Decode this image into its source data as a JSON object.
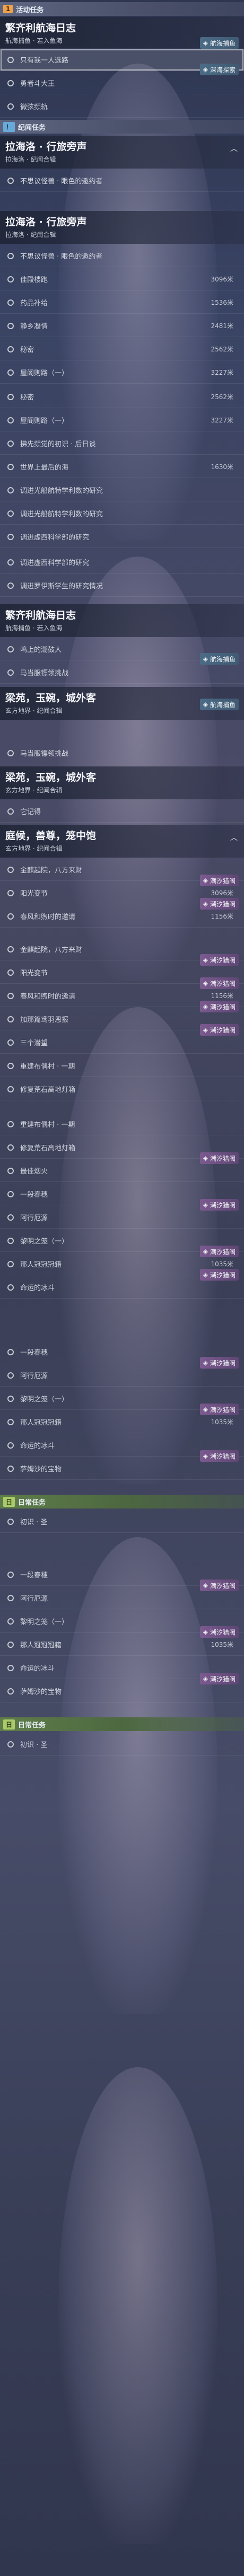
{
  "labels": {
    "quest_icon": "！",
    "chevron_up": "︿",
    "chevron_down": "﹀"
  },
  "colors": {
    "activity": "#f0a24a",
    "record": "#68a9d8",
    "daily": "#a9c96a"
  },
  "s1": {
    "tag": "1",
    "bar": "活动任务",
    "title": "繁齐利航海日志",
    "sub": "航海捕鱼 · 若入鱼海",
    "items": [
      "只有我一人选路",
      "勇者斗大王",
      "微弦频轨"
    ],
    "badges": [
      "航海捕鱼",
      "深海探索"
    ]
  },
  "s2": {
    "bar": "纪闻任务",
    "title": "拉海洛 · 行旅旁声",
    "sub": "拉海洛 · 纪闻合辑",
    "items": [
      "不思议怪兽 · 眼色的邀约者"
    ]
  },
  "s3": {
    "title": "拉海洛 · 行旅旁声",
    "sub": "拉海洛 · 纪闻合辑",
    "items": [
      "不思议怪兽 · 眼色的邀约者",
      "佳殿楼跑",
      "药品补给",
      "静乡凝情",
      "秘密",
      "屋阁则路（一）"
    ],
    "vals": [
      "",
      "3096米",
      "1536米",
      "2481米",
      "2562米",
      "3227米"
    ]
  },
  "s4": {
    "items": [
      "秘密",
      "屋阁则路（一）",
      "拂先频觉的初识 · 后日谈",
      "世界上最后的海",
      "调进光船航特学利数的研究",
      "调进光船航特学利数的研究",
      "调进虚西科学部的研究"
    ],
    "vals": [
      "2562米",
      "3227米",
      "",
      "1630米",
      "",
      "",
      ""
    ]
  },
  "s5": {
    "items": [
      "调进虚西科学部的研究",
      "调进罗伊斯学生的研究情况"
    ]
  },
  "s6": {
    "title": "繁齐利航海日志",
    "sub": "航海捕鱼 · 若入鱼海",
    "items": [
      "鸣上的潮鼓人",
      "马当服镖领挑战"
    ],
    "badge": "航海捕鱼"
  },
  "s7": {
    "title": "梁苑，玉碗，城外客",
    "sub": "玄方地界 · 纪闻合辑",
    "badge": "航海捕鱼"
  },
  "s8": {
    "items": [
      "马当服镖领挑战"
    ],
    "title": "梁苑，玉碗，城外客",
    "sub": "玄方地界 · 纪闻合辑",
    "items2": [
      "它记得"
    ]
  },
  "s9": {
    "title": "庭候，兽尊，笼中饱",
    "sub": "玄方地界 · 纪闻合辑",
    "items": [
      "金麒起院，八方来财",
      "阳光变节",
      "春风和煦时的邀请"
    ],
    "vals": [
      "",
      "3096米",
      "1156米"
    ],
    "badges": [
      "潮汐猎阀",
      "潮汐猎阀"
    ]
  },
  "s10": {
    "items": [
      "金麒起院，八方来财",
      "阳光变节",
      "春风和煦时的邀请",
      "加那篇鸢羽恩报",
      "三个潜望",
      "重建布偶村 · 一期",
      "修复荒石高地灯箱"
    ],
    "vals": [
      "",
      "",
      "1156米",
      "",
      "",
      "",
      ""
    ],
    "badges": [
      "潮汐猎阀",
      "潮汐猎阀",
      "潮汐猎阀",
      "潮汐猎阀"
    ]
  },
  "s11": {
    "items": [
      "重建布偶村 · 一期",
      "修复荒石高地灯箱",
      "最佳烟火",
      "一段春穗",
      "阿行厄源",
      "黎明之笼（一）",
      "那人冠冠冠籍",
      "命运的冰斗"
    ],
    "vals": [
      "",
      "",
      "",
      "",
      "",
      "",
      "1035米",
      ""
    ],
    "badges": [
      "潮汐猎阀",
      "潮汐猎阀",
      "潮汐猎阀",
      "潮汐猎阀"
    ]
  },
  "s12": {
    "items": [
      "一段春穗",
      "阿行厄源",
      "黎明之笼（一）",
      "那人冠冠冠籍",
      "命运的冰斗",
      "萨姆沙的宝物"
    ],
    "vals": [
      "",
      "",
      "",
      "1035米",
      "",
      ""
    ],
    "badges": [
      "潮汐猎阀",
      "潮汐猎阀",
      "潮汐猎阀"
    ]
  },
  "s13": {
    "tag": "日",
    "bar": "日常任务",
    "items": [
      "初识 · 圣"
    ]
  },
  "s14": {
    "items": [
      "一段春穗",
      "阿行厄源",
      "黎明之笼（一）",
      "那人冠冠冠籍",
      "命运的冰斗",
      "萨姆沙的宝物"
    ],
    "vals": [
      "",
      "",
      "",
      "1035米",
      "",
      ""
    ],
    "badges": [
      "潮汐猎阀",
      "潮汐猎阀",
      "潮汐猎阀"
    ]
  },
  "s15": {
    "tag": "日",
    "bar": "日常任务",
    "items": [
      "初识 · 圣"
    ]
  }
}
